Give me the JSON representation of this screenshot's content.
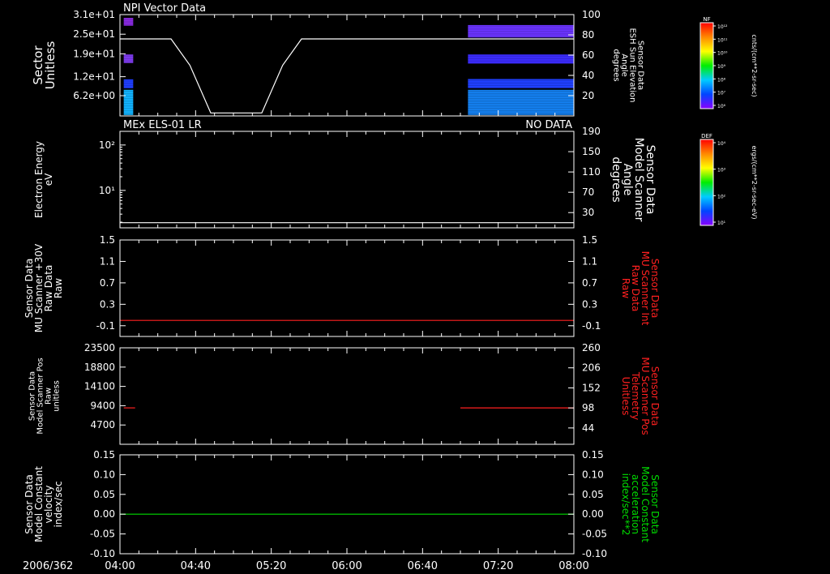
{
  "colors": {
    "background": "#000000",
    "axis": "#ffffff",
    "trace_white": "#ffffff",
    "trace_red": "#ff2020",
    "trace_green": "#00dd00",
    "ylabel_red": "#ff2020",
    "ylabel_green": "#00dd00"
  },
  "date_label": "2006/362",
  "chart_data": [
    {
      "type": "heatmap",
      "title": "NPI Vector Data",
      "status": "",
      "xlim": [
        "04:00",
        "08:00"
      ],
      "ylabel": "Sector\nUnitless",
      "yticks": [
        "3.1e+01",
        "2.5e+01",
        "1.9e+01",
        "1.2e+01",
        "6.2e+00"
      ],
      "ylim": [
        0,
        31
      ],
      "right_ylabel": "Sensor Data\nESH Sun Elevation\nAngle\ndegrees",
      "right_ylabel_color": "#ffffff",
      "right_ylim": [
        0,
        100
      ],
      "right_yticks": [
        "100",
        "80",
        "60",
        "40",
        "20"
      ],
      "colorbar": {
        "label": "NF",
        "units": "cnts/(cm**2-sr-sec)",
        "tick_labels": [
          "10¹²",
          "10¹¹",
          "10¹⁰",
          "10⁹",
          "10⁸",
          "10⁷",
          "10⁶"
        ],
        "colors": [
          "#ff0000",
          "#ff8800",
          "#ffff00",
          "#00ee00",
          "#00ccff",
          "#0044ff",
          "#8800ff"
        ]
      },
      "blocks": [
        {
          "x0": "04:02",
          "x1": "04:07",
          "y0": 27.6,
          "y1": 30.0,
          "color": "#8a2be2"
        },
        {
          "x0": "04:02",
          "x1": "04:07",
          "y0": 16.2,
          "y1": 18.8,
          "color": "#7f3cf0"
        },
        {
          "x0": "04:02",
          "x1": "04:07",
          "y0": 8.5,
          "y1": 11.2,
          "color": "#1f3fff"
        },
        {
          "x0": "04:02",
          "x1": "04:07",
          "y0": 0.3,
          "y1": 8.0,
          "color": "#12b4ff"
        },
        {
          "x0": "07:04",
          "x1": "08:00",
          "y0": 24.0,
          "y1": 27.8,
          "color": "#6b34ff"
        },
        {
          "x0": "07:04",
          "x1": "08:00",
          "y0": 16.0,
          "y1": 18.8,
          "color": "#3c2cff"
        },
        {
          "x0": "07:04",
          "x1": "08:00",
          "y0": 8.5,
          "y1": 11.3,
          "color": "#2040ff"
        },
        {
          "x0": "07:04",
          "x1": "08:00",
          "y0": 0.3,
          "y1": 8.0,
          "color": "#1480f0"
        }
      ],
      "line": {
        "name": "",
        "axis": "right",
        "color": "#ffffff",
        "x": [
          "04:00",
          "04:27",
          "04:37",
          "04:48",
          "05:15",
          "05:26",
          "05:36",
          "08:00"
        ],
        "y": [
          76,
          76,
          50,
          3,
          3,
          50,
          76,
          76
        ]
      }
    },
    {
      "type": "line",
      "title": "MEx ELS-01 LR",
      "status": "NO DATA",
      "xlim": [
        "04:00",
        "08:00"
      ],
      "ylabel": "Electron Energy\neV",
      "log_y": true,
      "ylim": [
        1.5,
        200
      ],
      "yticks": [
        "10²",
        "10¹"
      ],
      "right_ylabel": "Sensor Data\nModel Scanner\nAngle\ndegrees",
      "right_ylabel_color": "#ffffff",
      "right_ylim": [
        0,
        190
      ],
      "right_yticks": [
        "190",
        "150",
        "110",
        "70",
        "30"
      ],
      "colorbar": {
        "label": "DEF",
        "units": "ergs/(cm**2-sr-sec-eV)",
        "tick_labels": [
          "10⁴",
          "10³",
          "10²",
          "10¹"
        ],
        "colors": [
          "#ff0000",
          "#ff8800",
          "#ffff00",
          "#00ee00",
          "#00ccff",
          "#0044ff",
          "#8800ff"
        ]
      },
      "line": {
        "name": "",
        "axis": "right",
        "color": "#ffffff",
        "x": [
          "04:00",
          "08:00"
        ],
        "y": [
          10,
          10
        ]
      }
    },
    {
      "type": "line",
      "title": "",
      "status": "",
      "xlim": [
        "04:00",
        "08:00"
      ],
      "ylabel": "Sensor Data\nMU Scanner +30V\nRaw Data\nRaw",
      "ylim": [
        -0.3,
        1.5
      ],
      "yticks": [
        "1.5",
        "1.1",
        "0.7",
        "0.3",
        "-0.1"
      ],
      "right_ylabel": "Sensor Data\nMU Scanner Int\nRaw Data\nRaw",
      "right_ylabel_color": "#ff2020",
      "right_ylim": [
        -0.3,
        1.5
      ],
      "right_yticks": [
        "1.5",
        "1.1",
        "0.7",
        "0.3",
        "-0.1"
      ],
      "line": {
        "name": "",
        "axis": "left",
        "color": "#ff2020",
        "x": [
          "04:00",
          "08:00"
        ],
        "y": [
          0.0,
          0.0
        ]
      }
    },
    {
      "type": "line",
      "title": "",
      "status": "",
      "xlim": [
        "04:00",
        "08:00"
      ],
      "ylabel": "Sensor Data\nModel Scanner Pos\nRaw\nunitless",
      "ylim": [
        0,
        23500
      ],
      "yticks": [
        "23500",
        "18800",
        "14100",
        "9400",
        "4700"
      ],
      "right_ylabel": "Sensor Data\nMU Scanner Pos\nTelemetry\nUnitless",
      "right_ylabel_color": "#ff2020",
      "right_ylim": [
        0,
        260
      ],
      "right_yticks": [
        "260",
        "206",
        "152",
        "98",
        "44"
      ],
      "segments": [
        {
          "name": "",
          "axis": "right",
          "color": "#ff2020",
          "x": [
            "04:02",
            "04:08"
          ],
          "y": [
            98,
            98
          ]
        },
        {
          "name": "",
          "axis": "right",
          "color": "#ff2020",
          "x": [
            "07:00",
            "08:00"
          ],
          "y": [
            98,
            98
          ]
        }
      ]
    },
    {
      "type": "line",
      "title": "",
      "status": "",
      "xlim": [
        "04:00",
        "08:00"
      ],
      "ylabel": "Sensor Data\nModel Constant\nvelocity\nindex/sec",
      "ylim": [
        -0.1,
        0.15
      ],
      "yticks": [
        "0.15",
        "0.10",
        "0.05",
        "0.00",
        "-0.05",
        "-0.10"
      ],
      "right_ylabel": "Sensor Data\nModel Constant\nacceleration\nindex/sec**2",
      "right_ylabel_color": "#00dd00",
      "right_ylim": [
        -0.1,
        0.15
      ],
      "right_yticks": [
        "0.15",
        "0.10",
        "0.05",
        "0.00",
        "-0.05",
        "-0.10"
      ],
      "line": {
        "name": "",
        "axis": "left",
        "color": "#00dd00",
        "x": [
          "04:00",
          "08:00"
        ],
        "y": [
          0.0,
          0.0
        ]
      },
      "xticks": [
        "04:00",
        "04:40",
        "05:20",
        "06:00",
        "06:40",
        "07:20",
        "08:00"
      ]
    }
  ]
}
